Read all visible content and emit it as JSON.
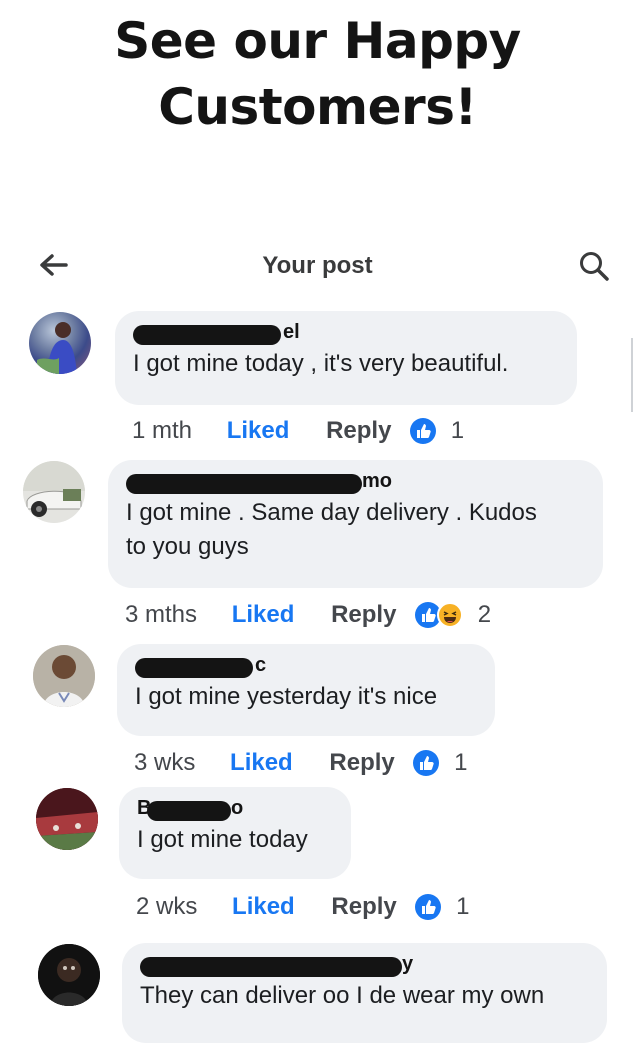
{
  "headline": {
    "line1": "See our Happy",
    "line2": "Customers!"
  },
  "topbar": {
    "title": "Your post",
    "back_icon": "back-arrow-icon",
    "search_icon": "search-icon"
  },
  "colors": {
    "accent": "#1877f2",
    "bubble": "#eff1f4",
    "text": "#1c1e21",
    "meta": "#44474c"
  },
  "comments": [
    {
      "name_visible": "el",
      "lines": [
        "I got mine today , it's very beautiful."
      ],
      "time": "1 mth",
      "liked": "Liked",
      "reply": "Reply",
      "reactions": [
        "like"
      ],
      "count": "1"
    },
    {
      "name_visible": "mo",
      "lines": [
        "I got mine . Same day delivery . Kudos",
        "to you guys"
      ],
      "time": "3 mths",
      "liked": "Liked",
      "reply": "Reply",
      "reactions": [
        "like",
        "haha"
      ],
      "count": "2"
    },
    {
      "name_visible": "c",
      "lines": [
        "I got mine yesterday it's nice"
      ],
      "time": "3 wks",
      "liked": "Liked",
      "reply": "Reply",
      "reactions": [
        "like"
      ],
      "count": "1"
    },
    {
      "name_visible_start": "B",
      "name_visible": "o",
      "lines": [
        "I got mine today"
      ],
      "time": "2 wks",
      "liked": "Liked",
      "reply": "Reply",
      "reactions": [
        "like"
      ],
      "count": "1"
    },
    {
      "name_visible": "y",
      "lines": [
        "They can deliver oo I de wear my own"
      ]
    }
  ]
}
